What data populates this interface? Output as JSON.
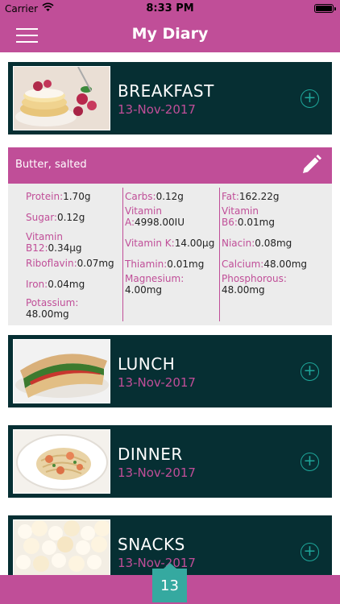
{
  "status_bar": {
    "carrier": "Carrier",
    "time": "8:33 PM"
  },
  "nav": {
    "title": "My Diary"
  },
  "meals": [
    {
      "name": "BREAKFAST",
      "date": "13-Nov-2017",
      "image": "pancakes-with-raspberries"
    },
    {
      "name": "LUNCH",
      "date": "13-Nov-2017",
      "image": "sandwich"
    },
    {
      "name": "DINNER",
      "date": "13-Nov-2017",
      "image": "shrimp-pasta"
    },
    {
      "name": "SNACKS",
      "date": "13-Nov-2017",
      "image": "popcorn"
    }
  ],
  "food_item": {
    "name": "Butter, salted",
    "nutrients": {
      "col1": [
        {
          "label": "Protein:",
          "value": "1.70g"
        },
        {
          "label": "Sugar:",
          "value": "0.12g"
        },
        {
          "label": "Vitamin B12:",
          "value": "0.34µg"
        },
        {
          "label": "Riboflavin:",
          "value": "0.07mg"
        },
        {
          "label": "Iron:",
          "value": "0.04mg"
        },
        {
          "label": "Potassium:",
          "value": "48.00mg"
        }
      ],
      "col2": [
        {
          "label": "Carbs:",
          "value": "0.12g"
        },
        {
          "label": "Vitamin A:",
          "value": "4998.00IU"
        },
        {
          "label": "Vitamin K:",
          "value": "14.00µg"
        },
        {
          "label": "Thiamin:",
          "value": "0.01mg"
        },
        {
          "label": "Magnesium:",
          "value": "4.00mg"
        }
      ],
      "col3": [
        {
          "label": "Fat:",
          "value": "162.22g"
        },
        {
          "label": "Vitamin B6:",
          "value": "0.01mg"
        },
        {
          "label": "Niacin:",
          "value": "0.08mg"
        },
        {
          "label": "Calcium:",
          "value": "48.00mg"
        },
        {
          "label": "Phosphorous:",
          "value": "48.00mg"
        }
      ]
    }
  },
  "page_indicator": "13",
  "colors": {
    "accent": "#c04e98",
    "meal_bg": "#062f33",
    "teal": "#35a9a0"
  },
  "icons": {
    "menu": "hamburger-menu-icon",
    "add": "plus-circle-icon",
    "edit": "pencil-icon",
    "wifi": "wifi-icon",
    "battery": "battery-icon"
  }
}
